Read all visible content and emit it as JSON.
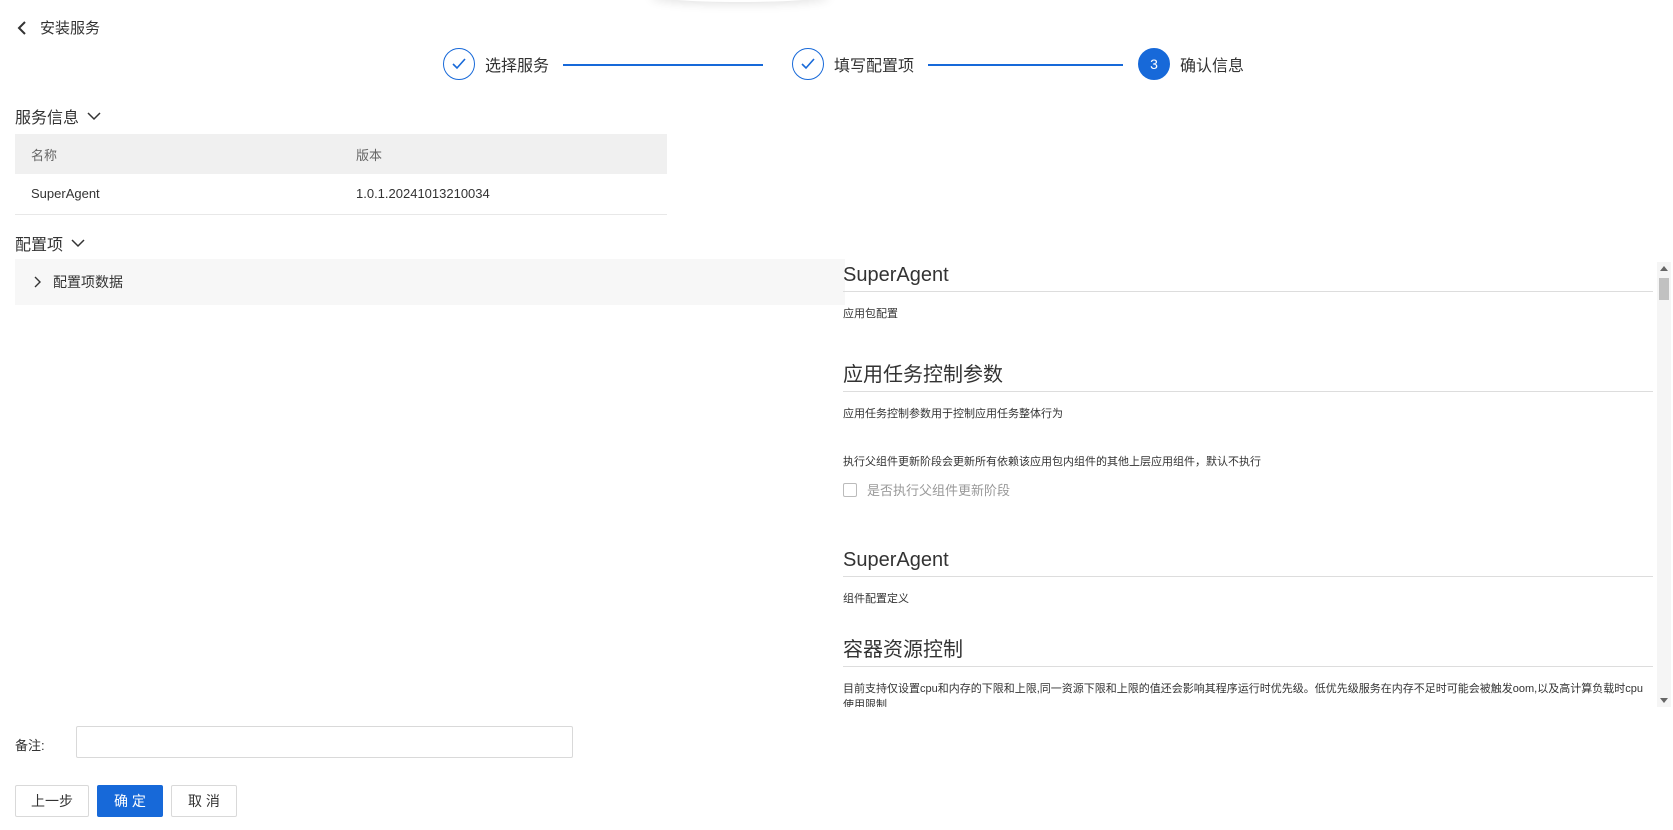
{
  "header": {
    "back_label": "安装服务"
  },
  "steps": [
    {
      "label": "选择服务",
      "state": "done"
    },
    {
      "label": "填写配置项",
      "state": "done"
    },
    {
      "label": "确认信息",
      "state": "active",
      "number": "3"
    }
  ],
  "service_info": {
    "title": "服务信息",
    "columns": [
      "名称",
      "版本"
    ],
    "rows": [
      {
        "name": "SuperAgent",
        "version": "1.0.1.20241013210034"
      }
    ]
  },
  "config": {
    "title": "配置项",
    "panel_label": "配置项数据",
    "sections": [
      {
        "heading": "SuperAgent",
        "desc": "应用包配置"
      },
      {
        "heading": "应用任务控制参数",
        "desc": "应用任务控制参数用于控制应用任务整体行为",
        "note": "执行父组件更新阶段会更新所有依赖该应用包内组件的其他上层应用组件，默认不执行",
        "checkbox_label": "是否执行父组件更新阶段"
      },
      {
        "heading": "SuperAgent",
        "desc": "组件配置定义"
      },
      {
        "heading": "容器资源控制",
        "desc": "目前支持仅设置cpu和内存的下限和上限,同一资源下限和上限的值还会影响其程序运行时优先级。低优先级服务在内存不足时可能会被触发oom,以及高计算负载时cpu使用限制"
      }
    ]
  },
  "remark": {
    "label": "备注:",
    "value": "",
    "placeholder": ""
  },
  "buttons": {
    "prev": "上一步",
    "confirm": "确 定",
    "cancel": "取 消"
  },
  "colors": {
    "primary": "#1769d9",
    "panel_bg": "#f7f7f7",
    "table_header_bg": "#f0f0f0"
  },
  "icons": {
    "back": "chevron-left-icon",
    "done_step": "check-icon",
    "collapse": "chevron-down-icon",
    "expand": "chevron-right-icon"
  }
}
